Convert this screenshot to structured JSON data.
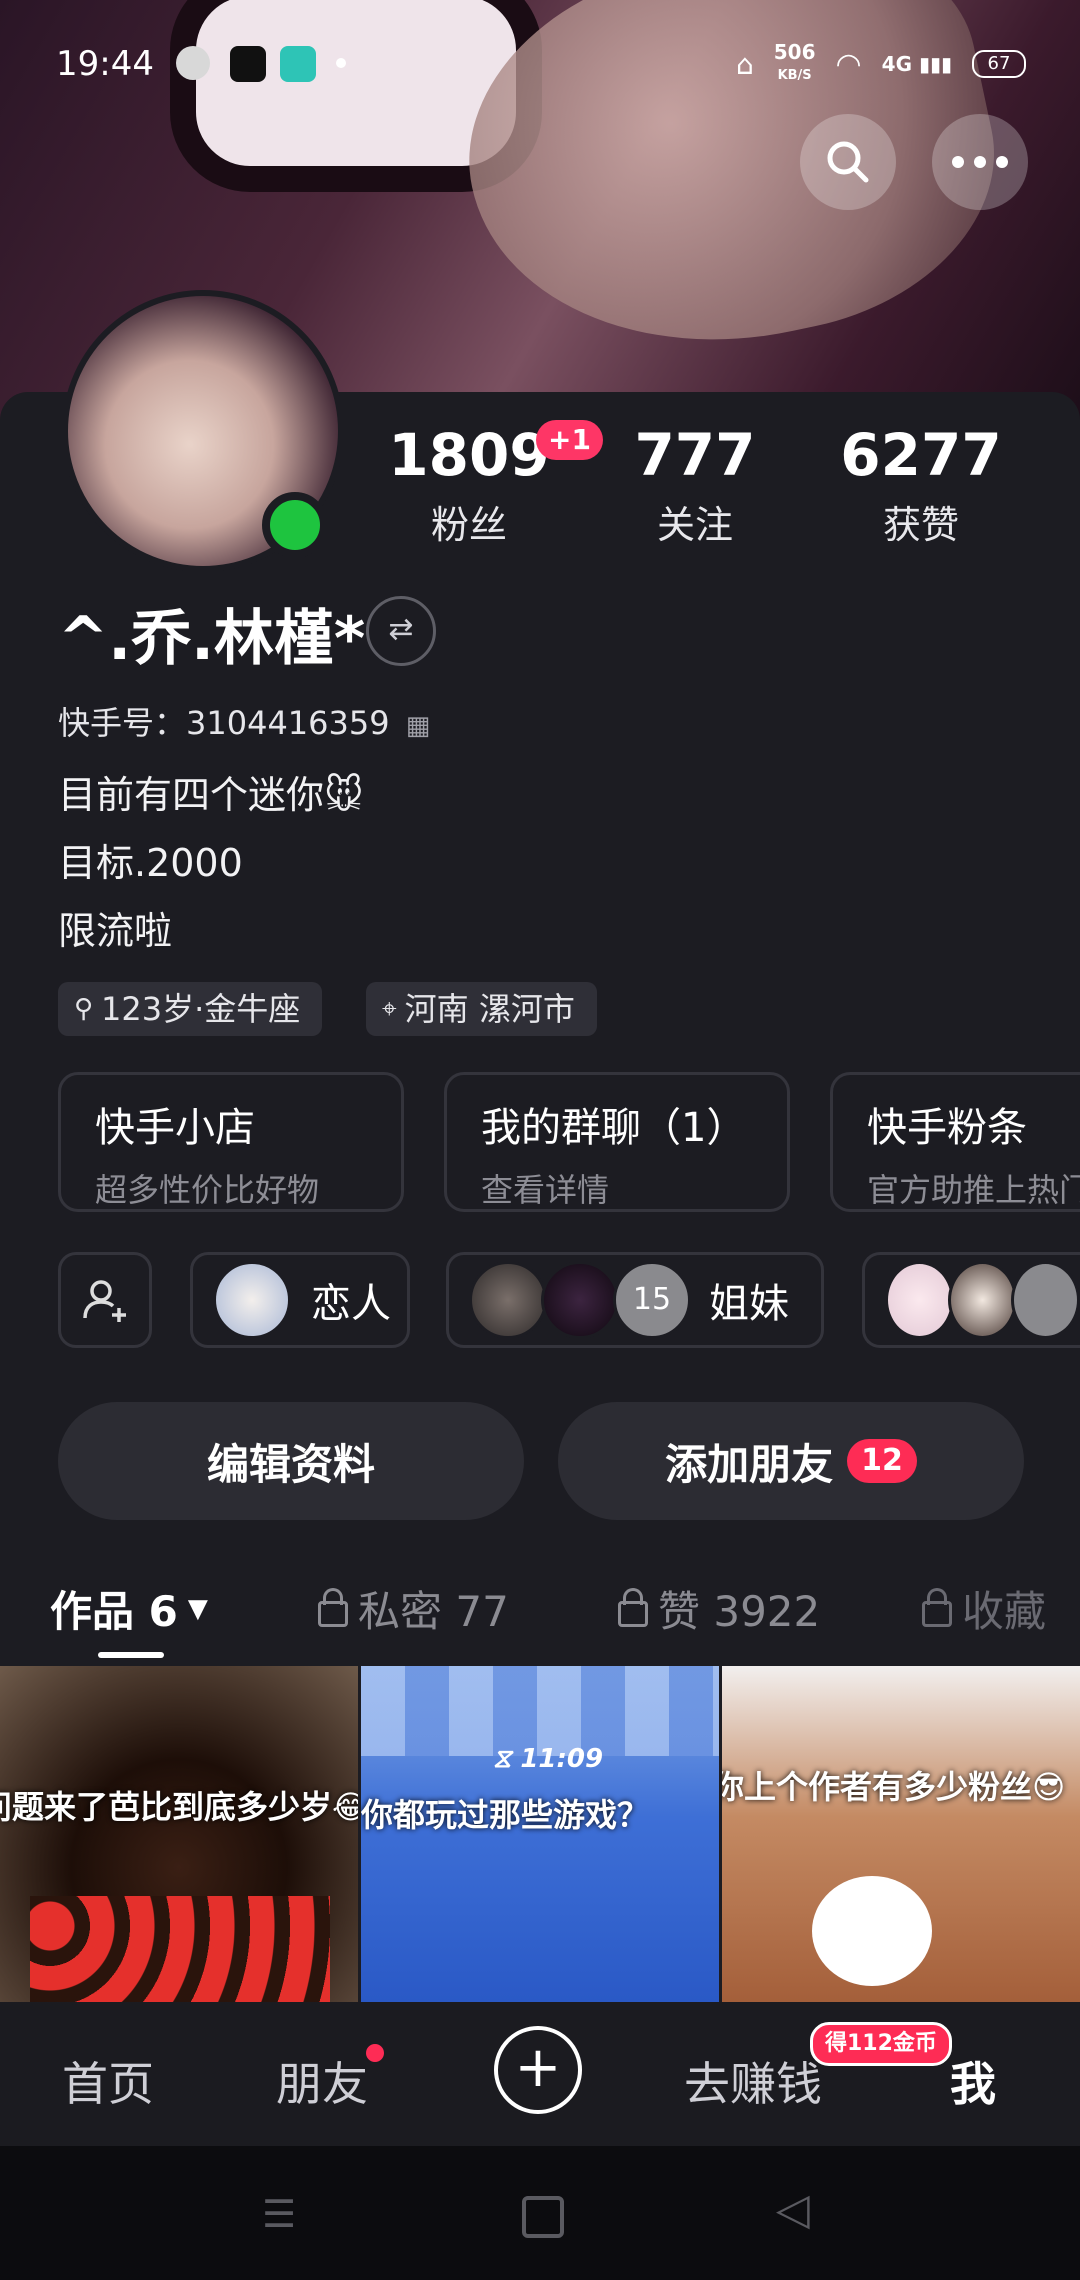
{
  "status_bar": {
    "time": "19:44",
    "speed": "506",
    "speed_unit": "KB/S",
    "network": "4G",
    "battery": "67"
  },
  "profile": {
    "followers": "1809",
    "followers_new": "+1",
    "followers_label": "粉丝",
    "following": "777",
    "following_label": "关注",
    "likes": "6277",
    "likes_label": "获赞",
    "name": "^.乔.林槿*",
    "kuaishou_id": "快手号：3104416359",
    "bio": [
      "目前有四个迷你🐭",
      "目标.2000",
      "限流啦"
    ],
    "tags": [
      "123岁·金牛座",
      "河南 漯河市"
    ]
  },
  "cards": [
    {
      "title": "快手小店",
      "subtitle": "超多性价比好物"
    },
    {
      "title": "我的群聊（1）",
      "subtitle": "查看详情"
    },
    {
      "title": "快手粉条",
      "subtitle": "官方助推上热门"
    }
  ],
  "relations": {
    "lover": "恋人",
    "sisters_count": "15",
    "sisters": "姐妹"
  },
  "buttons": {
    "edit": "编辑资料",
    "add_friend": "添加朋友",
    "add_friend_badge": "12"
  },
  "tabs": [
    {
      "label": "作品 6"
    },
    {
      "label": "私密 77"
    },
    {
      "label": "赞 3922"
    },
    {
      "label": "收藏"
    }
  ],
  "videos": [
    {
      "caption": "问题来了芭比到底多少岁😂"
    },
    {
      "caption": "你都玩过那些游戏？",
      "duration": "11:09"
    },
    {
      "caption": "你上个作者有多少粉丝😎"
    }
  ],
  "bottom_nav": {
    "home": "首页",
    "friends": "朋友",
    "earn": "去赚钱",
    "earn_badge": "得112金币",
    "me": "我"
  },
  "colors": {
    "accent": "#fe2c55",
    "online": "#1ec43f",
    "background": "#1c1c22"
  }
}
